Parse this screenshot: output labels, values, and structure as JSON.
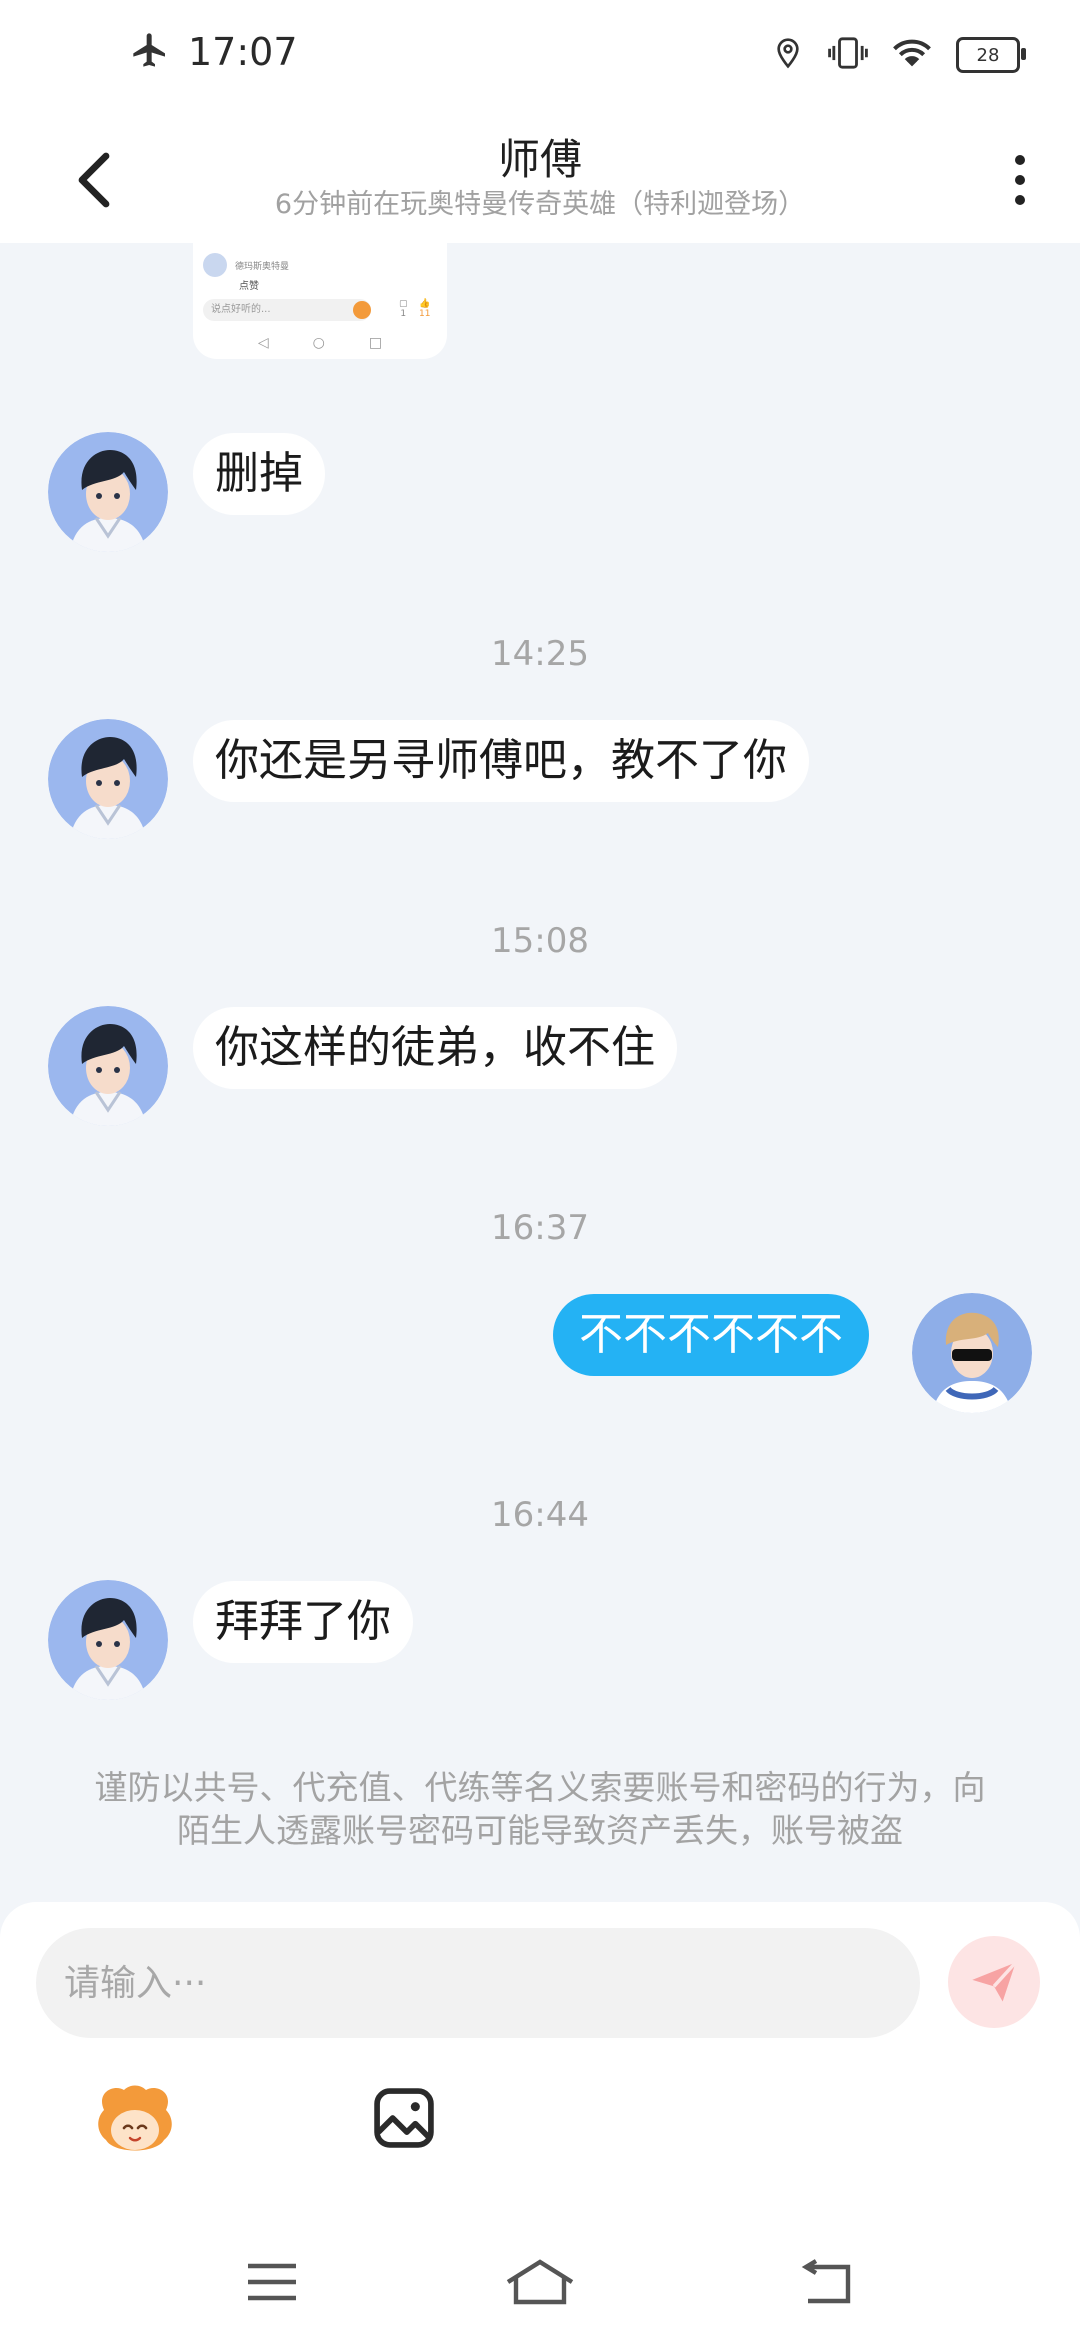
{
  "status_bar": {
    "time": "17:07",
    "battery": "28"
  },
  "header": {
    "title": "师傅",
    "subtitle": "6分钟前在玩奥特曼传奇英雄（特利迦登场）"
  },
  "messages": [
    {
      "from": "other",
      "text": "删掉"
    },
    {
      "timestamp": "14:25"
    },
    {
      "from": "other",
      "text": "你还是另寻师傅吧，教不了你"
    },
    {
      "timestamp": "15:08"
    },
    {
      "from": "other",
      "text": "你这样的徒弟，收不住"
    },
    {
      "timestamp": "16:37"
    },
    {
      "from": "me",
      "text": "不不不不不不"
    },
    {
      "timestamp": "16:44"
    },
    {
      "from": "other",
      "text": "拜拜了你"
    }
  ],
  "thumbnail": {
    "name_text": "德玛斯奥特曼",
    "reply_text": "点赞",
    "input_text": "说点好听的...",
    "counts": [
      "1",
      "11"
    ]
  },
  "safety_notice": "谨防以共号、代充值、代练等名义索要账号和密码的行为，向陌生人透露账号密码可能导致资产丢失，账号被盗",
  "composer": {
    "placeholder": "请输入···"
  },
  "colors": {
    "my_bubble": "#24b2f4",
    "background": "#f2f5f9",
    "send_button": "#fde4e4",
    "send_icon": "#f7a3a3"
  },
  "icons": [
    "airplane-icon",
    "location-icon",
    "vibrate-icon",
    "wifi-icon",
    "battery-icon",
    "back-icon",
    "more-icon",
    "send-icon",
    "emoji-icon",
    "image-icon",
    "menu-icon",
    "home-icon",
    "back-nav-icon"
  ]
}
